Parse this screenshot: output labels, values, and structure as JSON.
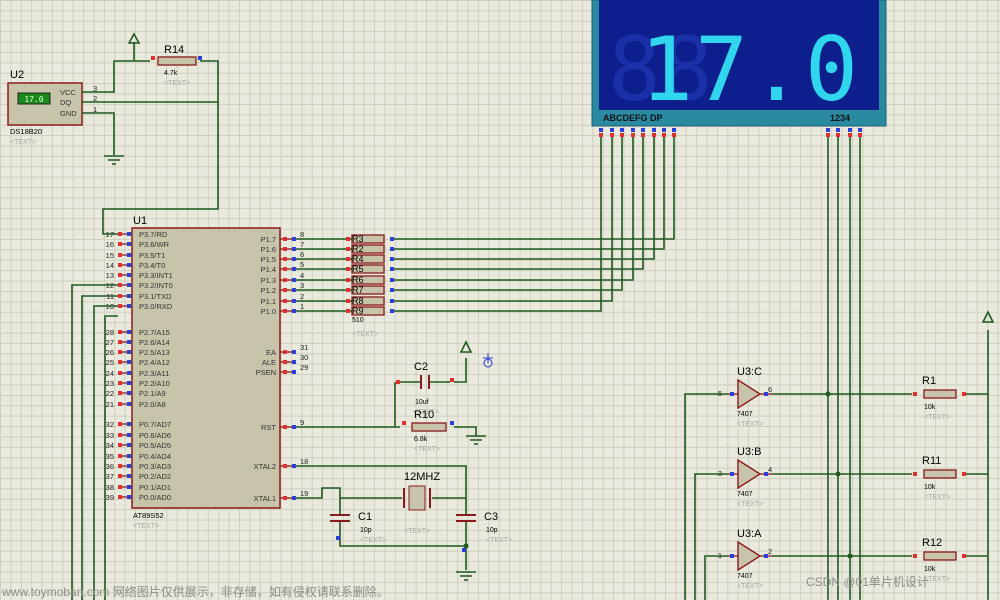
{
  "u1": {
    "ref": "U1",
    "part": "AT89S52",
    "text": "<TEXT>",
    "left_pins": [
      {
        "num": "17",
        "name": "P3.7/RD"
      },
      {
        "num": "16",
        "name": "P3.6/WR"
      },
      {
        "num": "15",
        "name": "P3.5/T1"
      },
      {
        "num": "14",
        "name": "P3.4/T0"
      },
      {
        "num": "13",
        "name": "P3.3/INT1"
      },
      {
        "num": "12",
        "name": "P3.2/INT0"
      },
      {
        "num": "11",
        "name": "P3.1/TXD"
      },
      {
        "num": "10",
        "name": "P3.0/RXD"
      },
      {
        "num": "28",
        "name": "P2.7/A15"
      },
      {
        "num": "27",
        "name": "P2.6/A14"
      },
      {
        "num": "26",
        "name": "P2.5/A13"
      },
      {
        "num": "25",
        "name": "P2.4/A12"
      },
      {
        "num": "24",
        "name": "P2.3/A11"
      },
      {
        "num": "23",
        "name": "P2.2/A10"
      },
      {
        "num": "22",
        "name": "P2.1/A9"
      },
      {
        "num": "21",
        "name": "P2.0/A8"
      },
      {
        "num": "32",
        "name": "P0.7/AD7"
      },
      {
        "num": "33",
        "name": "P0.6/AD6"
      },
      {
        "num": "34",
        "name": "P0.5/AD5"
      },
      {
        "num": "35",
        "name": "P0.4/AD4"
      },
      {
        "num": "36",
        "name": "P0.3/AD3"
      },
      {
        "num": "37",
        "name": "P0.2/AD2"
      },
      {
        "num": "38",
        "name": "P0.1/AD1"
      },
      {
        "num": "39",
        "name": "P0.0/AD0"
      }
    ],
    "right_pins": [
      {
        "num": "8",
        "name": "P1.7"
      },
      {
        "num": "7",
        "name": "P1.6"
      },
      {
        "num": "6",
        "name": "P1.5"
      },
      {
        "num": "5",
        "name": "P1.4"
      },
      {
        "num": "4",
        "name": "P1.3"
      },
      {
        "num": "3",
        "name": "P1.2"
      },
      {
        "num": "2",
        "name": "P1.1"
      },
      {
        "num": "1",
        "name": "P1.0"
      },
      {
        "num": "31",
        "name": "EA"
      },
      {
        "num": "30",
        "name": "ALE"
      },
      {
        "num": "29",
        "name": "PSEN"
      },
      {
        "num": "9",
        "name": "RST"
      },
      {
        "num": "18",
        "name": "XTAL2"
      },
      {
        "num": "19",
        "name": "XTAL1"
      }
    ]
  },
  "u2": {
    "ref": "U2",
    "part": "DS18B20",
    "text": "<TEXT>",
    "display": "17.0",
    "pins": [
      {
        "num": "3",
        "name": "VCC"
      },
      {
        "num": "2",
        "name": "DQ"
      },
      {
        "num": "1",
        "name": "GND"
      }
    ]
  },
  "r14": {
    "ref": "R14",
    "value": "4.7k",
    "text": "<TEXT>"
  },
  "rpack": {
    "labels": [
      "R3",
      "R2",
      "R4",
      "R5",
      "R6",
      "R7",
      "R8",
      "R9"
    ],
    "value": "510",
    "text": "<TEXT>"
  },
  "display": {
    "digits": "17.0",
    "segment_label": "ABCDEFG DP",
    "digit_label": "1234",
    "color": "#2fd6ee"
  },
  "c2": {
    "ref": "C2",
    "value": "10uf",
    "text": "<TEXT>"
  },
  "r10": {
    "ref": "R10",
    "value": "6.8k",
    "text": "<TEXT>"
  },
  "crystal": {
    "label": "12MHZ",
    "text": "<TEXT>"
  },
  "c1": {
    "ref": "C1",
    "value": "10p",
    "text": "<TEXT>"
  },
  "c3": {
    "ref": "C3",
    "value": "10p",
    "text": "<TEXT>"
  },
  "buffers": [
    {
      "ref": "U3:C",
      "part": "7407",
      "in": "5",
      "out": "6",
      "text": "<TEXT>"
    },
    {
      "ref": "U3:B",
      "part": "7407",
      "in": "3",
      "out": "4",
      "text": "<TEXT>"
    },
    {
      "ref": "U3:A",
      "part": "7407",
      "in": "1",
      "out": "2",
      "text": "<TEXT>"
    }
  ],
  "resistors_right": [
    {
      "ref": "R1",
      "value": "10k",
      "text": "<TEXT>"
    },
    {
      "ref": "R11",
      "value": "10k",
      "text": "<TEXT>"
    },
    {
      "ref": "R12",
      "value": "10k",
      "text": "<TEXT>"
    }
  ],
  "watermark_left": "www.toymoban.com 网络图片仅供展示，非存储，如有侵权请联系删除。",
  "watermark_right": "CSDN @01单片机设计"
}
